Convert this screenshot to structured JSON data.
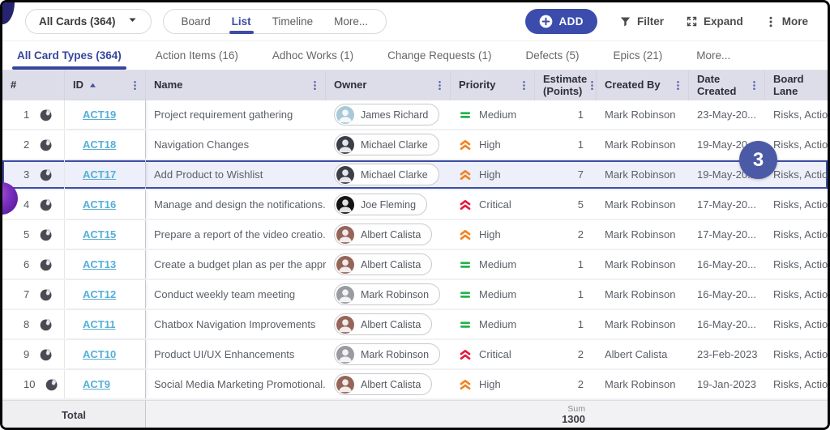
{
  "topbar": {
    "cards_dropdown_label": "All Cards (364)",
    "views": [
      {
        "label": "Board",
        "active": false
      },
      {
        "label": "List",
        "active": true
      },
      {
        "label": "Timeline",
        "active": false
      },
      {
        "label": "More...",
        "active": false
      }
    ],
    "add_label": "ADD",
    "actions": [
      {
        "label": "Filter",
        "icon": "filter-icon"
      },
      {
        "label": "Expand",
        "icon": "expand-icon"
      },
      {
        "label": "More",
        "icon": "more-kebab-icon"
      }
    ]
  },
  "tabs": [
    {
      "label": "All Card Types (364)",
      "active": true
    },
    {
      "label": "Action Items (16)",
      "active": false
    },
    {
      "label": "Adhoc Works (1)",
      "active": false
    },
    {
      "label": "Change Requests (1)",
      "active": false
    },
    {
      "label": "Defects (5)",
      "active": false
    },
    {
      "label": "Epics (21)",
      "active": false
    },
    {
      "label": "More...",
      "active": false
    }
  ],
  "table": {
    "columns": [
      {
        "label": "#",
        "kebab": false,
        "sort": null
      },
      {
        "label": "ID",
        "kebab": true,
        "sort": "asc"
      },
      {
        "label": "Name",
        "kebab": true,
        "sort": null
      },
      {
        "label": "Owner",
        "kebab": true,
        "sort": null
      },
      {
        "label": "Priority",
        "kebab": true,
        "sort": null
      },
      {
        "label": "Estimate (Points)",
        "kebab": true,
        "sort": null
      },
      {
        "label": "Created By",
        "kebab": true,
        "sort": null
      },
      {
        "label": "Date Created",
        "kebab": true,
        "sort": null
      },
      {
        "label": "Board Lane",
        "kebab": false,
        "sort": null
      }
    ],
    "rows": [
      {
        "num": "1",
        "id": "ACT19",
        "name": "Project requirement gathering",
        "owner": "James Richard",
        "priority": "Medium",
        "estimate": "1",
        "created_by": "Mark Robinson",
        "date_created": "23-May-20...",
        "board_lane": "Risks, Action",
        "selected": false
      },
      {
        "num": "2",
        "id": "ACT18",
        "name": "Navigation Changes",
        "owner": "Michael Clarke",
        "priority": "High",
        "estimate": "1",
        "created_by": "Mark Robinson",
        "date_created": "19-May-20...",
        "board_lane": "Risks, Action",
        "selected": false
      },
      {
        "num": "3",
        "id": "ACT17",
        "name": "Add Product to Wishlist",
        "owner": "Michael Clarke",
        "priority": "High",
        "estimate": "7",
        "created_by": "Mark Robinson",
        "date_created": "19-May-20...",
        "board_lane": "Risks, Action",
        "selected": true
      },
      {
        "num": "4",
        "id": "ACT16",
        "name": "Manage and design the notifications...",
        "owner": "Joe Fleming",
        "priority": "Critical",
        "estimate": "5",
        "created_by": "Mark Robinson",
        "date_created": "17-May-20...",
        "board_lane": "Risks, Action",
        "selected": false
      },
      {
        "num": "5",
        "id": "ACT15",
        "name": "Prepare a report of the video creatio...",
        "owner": "Albert Calista",
        "priority": "High",
        "estimate": "2",
        "created_by": "Mark Robinson",
        "date_created": "17-May-20...",
        "board_lane": "Risks, Action",
        "selected": false
      },
      {
        "num": "6",
        "id": "ACT13",
        "name": "Create a budget plan as per the appr...",
        "owner": "Albert Calista",
        "priority": "Medium",
        "estimate": "1",
        "created_by": "Mark Robinson",
        "date_created": "16-May-20...",
        "board_lane": "Risks, Action",
        "selected": false
      },
      {
        "num": "7",
        "id": "ACT12",
        "name": "Conduct weekly team meeting",
        "owner": "Mark Robinson",
        "priority": "Medium",
        "estimate": "1",
        "created_by": "Mark Robinson",
        "date_created": "16-May-20...",
        "board_lane": "Risks, Action",
        "selected": false
      },
      {
        "num": "8",
        "id": "ACT11",
        "name": "Chatbox Navigation Improvements",
        "owner": "Albert Calista",
        "priority": "Medium",
        "estimate": "1",
        "created_by": "Mark Robinson",
        "date_created": "16-May-20...",
        "board_lane": "Risks, Action",
        "selected": false
      },
      {
        "num": "9",
        "id": "ACT10",
        "name": "Product UI/UX Enhancements",
        "owner": "Mark Robinson",
        "priority": "Critical",
        "estimate": "2",
        "created_by": "Albert Calista",
        "date_created": "23-Feb-2023",
        "board_lane": "Risks, Action",
        "selected": false
      },
      {
        "num": "10",
        "id": "ACT9",
        "name": "Social Media Marketing Promotional...",
        "owner": "Albert Calista",
        "priority": "High",
        "estimate": "2",
        "created_by": "Mark Robinson",
        "date_created": "19-Jan-2023",
        "board_lane": "Risks, Action",
        "selected": false
      }
    ],
    "footer": {
      "total_label": "Total",
      "sum_label": "Sum",
      "sum_value": "1300"
    }
  },
  "priorities": {
    "Medium": {
      "color": "#24b24c",
      "icon": "equals"
    },
    "High": {
      "color": "#f5821f",
      "icon": "chevrons"
    },
    "Critical": {
      "color": "#e51b3d",
      "icon": "chevrons"
    }
  },
  "people": {
    "James Richard": "#a9c9d9",
    "Michael Clarke": "#3c3f4a",
    "Joe Fleming": "#141414",
    "Albert Calista": "#96655a",
    "Mark Robinson": "#9a9aa2"
  },
  "annotations": {
    "step_badge": "3"
  },
  "colors": {
    "accent": "#3e4da3",
    "link": "#56aed6",
    "badge": "#4b5aa7",
    "header_bg": "#dcdde9",
    "selected_bg": "#edeffa"
  }
}
